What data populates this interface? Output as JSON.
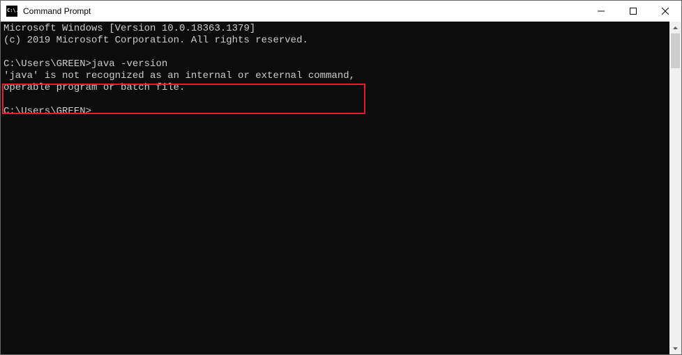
{
  "titlebar": {
    "icon_label": "C:\\.",
    "title": "Command Prompt"
  },
  "terminal": {
    "line1": "Microsoft Windows [Version 10.0.18363.1379]",
    "line2": "(c) 2019 Microsoft Corporation. All rights reserved.",
    "prompt1_path": "C:\\Users\\GREEN>",
    "prompt1_cmd": "java -version",
    "error_line1": "'java' is not recognized as an internal or external command,",
    "error_line2": "operable program or batch file.",
    "prompt2_path": "C:\\Users\\GREEN>"
  }
}
